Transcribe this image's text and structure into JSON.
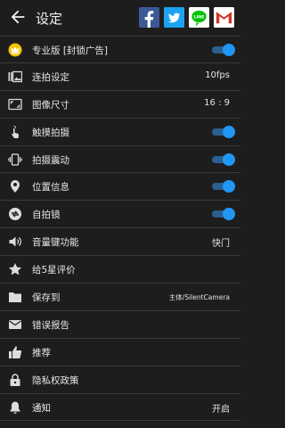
{
  "header": {
    "title": "设定"
  },
  "share": [
    {
      "name": "facebook-icon",
      "color": "#3b5998"
    },
    {
      "name": "twitter-icon",
      "color": "#1da1f2"
    },
    {
      "name": "line-icon",
      "color": "#00c300"
    },
    {
      "name": "gmail-icon",
      "color": "#d93025"
    }
  ],
  "settings": {
    "items": [
      {
        "label": "专业版 [封锁广告]",
        "icon": "crown-badge-icon",
        "toggle": true
      },
      {
        "label": "连拍设定",
        "icon": "burst-photos-icon",
        "value": "10fps"
      },
      {
        "label": "图像尺寸",
        "icon": "aspect-ratio-icon",
        "value": "16 : 9"
      },
      {
        "label": "触摸拍摄",
        "icon": "touch-icon",
        "toggle": true
      },
      {
        "label": "拍摄震动",
        "icon": "vibration-icon",
        "toggle": true
      },
      {
        "label": "位置信息",
        "icon": "location-pin-icon",
        "toggle": true
      },
      {
        "label": "自拍镜",
        "icon": "switch-camera-icon",
        "toggle": true
      },
      {
        "label": "音量键功能",
        "icon": "volume-icon",
        "value": "快门"
      },
      {
        "label": "给5星评价",
        "icon": "star-icon"
      },
      {
        "label": "保存到",
        "icon": "folder-icon",
        "value": "主体/SilentCamera"
      },
      {
        "label": "错误报告",
        "icon": "mail-icon"
      },
      {
        "label": "推荐",
        "icon": "thumb-up-icon"
      },
      {
        "label": "隐私权政策",
        "icon": "lock-icon"
      },
      {
        "label": "通知",
        "icon": "bell-icon",
        "value": "开启"
      }
    ]
  },
  "colors": {
    "accent": "#2196f3",
    "background": "#1d1d1d",
    "divider": "#3a3a3a",
    "crown": "#f5c400"
  }
}
